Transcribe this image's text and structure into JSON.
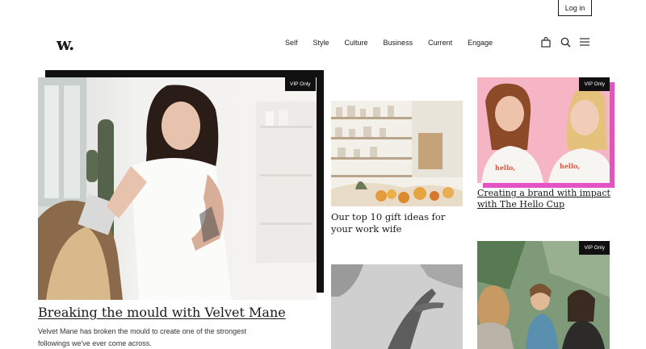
{
  "header": {
    "login_label": "Log in",
    "logo_text": "w.",
    "nav": [
      "Self",
      "Style",
      "Culture",
      "Business",
      "Current",
      "Engage"
    ],
    "icons": [
      "bag-icon",
      "search-icon",
      "menu-icon"
    ]
  },
  "feature": {
    "badge": "VIP Only",
    "title": "Breaking the mould with Velvet Mane",
    "description": "Velvet Mane has broken the mould to create one of the strongest followings we've ever come across."
  },
  "middle": {
    "title": "Our top 10 gift ideas for your work wife"
  },
  "right": {
    "badge_top": "VIP Only",
    "shirt_text": "hello, gorgeous",
    "title": "Creating a brand with impact with The Hello Cup",
    "badge_bottom": "VIP Only"
  },
  "colors": {
    "accent_pink": "#e353c3",
    "badge_bg": "#111111"
  }
}
